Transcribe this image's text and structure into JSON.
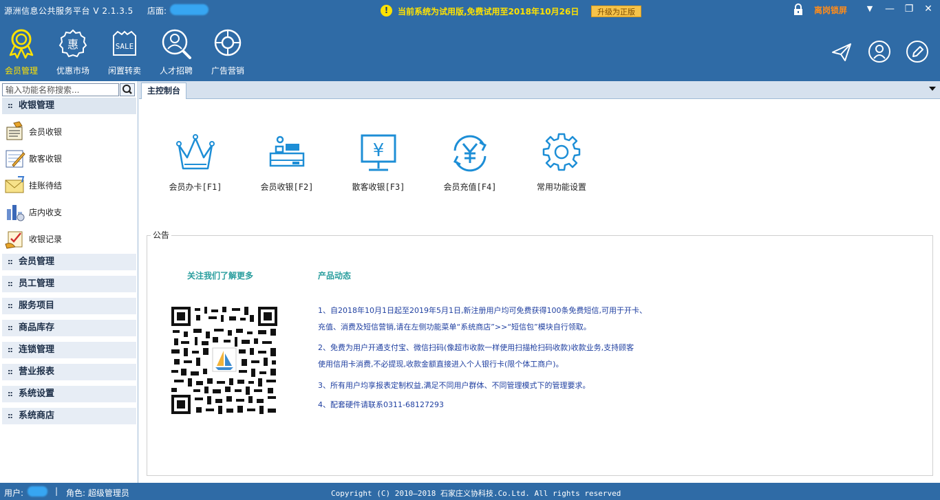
{
  "titlebar": {
    "app_title": "源洲信息公共服务平台 V 2.1.3.5",
    "store_label": "店面:",
    "trial_icon": "!",
    "trial_text": "当前系统为试用版,免费试用至2018年10月26日",
    "upgrade_label": "升级为正版",
    "lock_text": "离岗锁屏",
    "win_dropdown": "▼",
    "win_minimize": "—",
    "win_restore": "❐",
    "win_close": "✕"
  },
  "nav": {
    "items": [
      {
        "label": "会员管理",
        "icon": "ribbon-icon",
        "active": true
      },
      {
        "label": "优惠市场",
        "icon": "discount-icon"
      },
      {
        "label": "闲置转卖",
        "icon": "sale-bag-icon"
      },
      {
        "label": "人才招聘",
        "icon": "magnifier-person-icon"
      },
      {
        "label": "广告营销",
        "icon": "lifebuoy-icon"
      }
    ],
    "right_icons": [
      "send-icon",
      "user-icon",
      "edit-icon"
    ]
  },
  "sidebar": {
    "search_placeholder": "输入功能名称搜索...",
    "first_group": "收银管理",
    "items": [
      {
        "label": "会员收银",
        "icon": "register-icon"
      },
      {
        "label": "散客收银",
        "icon": "notepad-icon"
      },
      {
        "label": "挂账待结",
        "icon": "envelope-icon"
      },
      {
        "label": "店内收支",
        "icon": "chart-icon"
      },
      {
        "label": "收银记录",
        "icon": "checklist-icon"
      }
    ],
    "groups": [
      "会员管理",
      "员工管理",
      "服务项目",
      "商品库存",
      "连锁管理",
      "营业报表",
      "系统设置",
      "系统商店"
    ]
  },
  "tabs": {
    "active": "主控制台"
  },
  "functions": [
    {
      "label": "会员办卡[F1]",
      "icon": "crown-icon"
    },
    {
      "label": "会员收银[F2]",
      "icon": "cash-register-icon"
    },
    {
      "label": "散客收银[F3]",
      "icon": "yen-monitor-icon"
    },
    {
      "label": "会员充值[F4]",
      "icon": "yen-refresh-icon"
    },
    {
      "label": "常用功能设置",
      "icon": "gear-icon"
    }
  ],
  "notice": {
    "title": "公告",
    "follow_title": "关注我们了解更多",
    "product_title": "产品动态",
    "lines": [
      "1、自2018年10月1日起至2019年5月1日,新注册用户均可免费获得100条免费短信,可用于开卡、",
      "充值、消费及短信营销,请在左侧功能菜单“系统商店”>>“短信包”模块自行领取。",
      "2、免费为用户开通支付宝、微信扫码(像超市收款一样使用扫描枪扫码收款)收款业务,支持顾客",
      "使用信用卡消费,不必提现,收款金额直接进入个人银行卡(限个体工商户)。",
      "3、所有用户均享报表定制权益,满足不同用户群体、不同管理模式下的管理要求。",
      "4、配套硬件请联系0311-68127293"
    ]
  },
  "statusbar": {
    "user_label": "用户:",
    "separator": "|",
    "role": "角色: 超级管理员",
    "copyright": "Copyright (C) 2010—2018 石家庄义协科技.Co.Ltd. All rights reserved"
  },
  "colors": {
    "header_bg": "#2f6ba6",
    "accent_yellow": "#ffe200",
    "icon_blue": "#1d8ed6",
    "notice_text": "#1f3fa0",
    "teal_heading": "#2a9e9e"
  }
}
